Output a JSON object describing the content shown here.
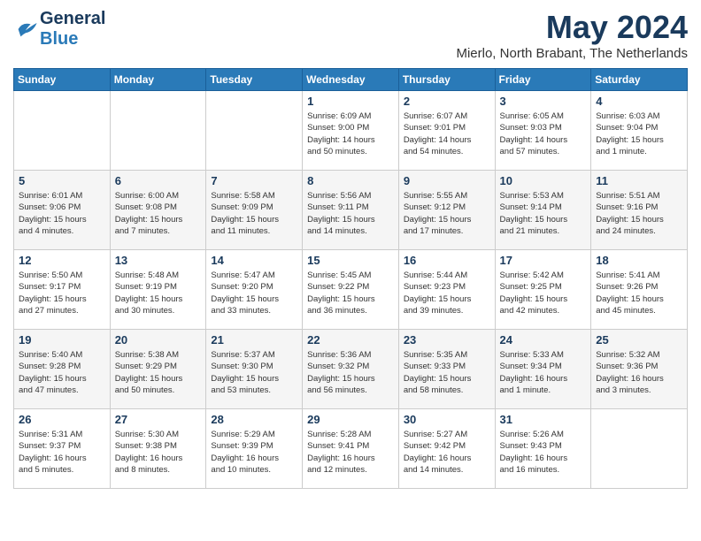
{
  "logo": {
    "line1": "General",
    "line2": "Blue"
  },
  "title": "May 2024",
  "subtitle": "Mierlo, North Brabant, The Netherlands",
  "weekdays": [
    "Sunday",
    "Monday",
    "Tuesday",
    "Wednesday",
    "Thursday",
    "Friday",
    "Saturday"
  ],
  "weeks": [
    [
      {
        "day": "",
        "info": ""
      },
      {
        "day": "",
        "info": ""
      },
      {
        "day": "",
        "info": ""
      },
      {
        "day": "1",
        "info": "Sunrise: 6:09 AM\nSunset: 9:00 PM\nDaylight: 14 hours\nand 50 minutes."
      },
      {
        "day": "2",
        "info": "Sunrise: 6:07 AM\nSunset: 9:01 PM\nDaylight: 14 hours\nand 54 minutes."
      },
      {
        "day": "3",
        "info": "Sunrise: 6:05 AM\nSunset: 9:03 PM\nDaylight: 14 hours\nand 57 minutes."
      },
      {
        "day": "4",
        "info": "Sunrise: 6:03 AM\nSunset: 9:04 PM\nDaylight: 15 hours\nand 1 minute."
      }
    ],
    [
      {
        "day": "5",
        "info": "Sunrise: 6:01 AM\nSunset: 9:06 PM\nDaylight: 15 hours\nand 4 minutes."
      },
      {
        "day": "6",
        "info": "Sunrise: 6:00 AM\nSunset: 9:08 PM\nDaylight: 15 hours\nand 7 minutes."
      },
      {
        "day": "7",
        "info": "Sunrise: 5:58 AM\nSunset: 9:09 PM\nDaylight: 15 hours\nand 11 minutes."
      },
      {
        "day": "8",
        "info": "Sunrise: 5:56 AM\nSunset: 9:11 PM\nDaylight: 15 hours\nand 14 minutes."
      },
      {
        "day": "9",
        "info": "Sunrise: 5:55 AM\nSunset: 9:12 PM\nDaylight: 15 hours\nand 17 minutes."
      },
      {
        "day": "10",
        "info": "Sunrise: 5:53 AM\nSunset: 9:14 PM\nDaylight: 15 hours\nand 21 minutes."
      },
      {
        "day": "11",
        "info": "Sunrise: 5:51 AM\nSunset: 9:16 PM\nDaylight: 15 hours\nand 24 minutes."
      }
    ],
    [
      {
        "day": "12",
        "info": "Sunrise: 5:50 AM\nSunset: 9:17 PM\nDaylight: 15 hours\nand 27 minutes."
      },
      {
        "day": "13",
        "info": "Sunrise: 5:48 AM\nSunset: 9:19 PM\nDaylight: 15 hours\nand 30 minutes."
      },
      {
        "day": "14",
        "info": "Sunrise: 5:47 AM\nSunset: 9:20 PM\nDaylight: 15 hours\nand 33 minutes."
      },
      {
        "day": "15",
        "info": "Sunrise: 5:45 AM\nSunset: 9:22 PM\nDaylight: 15 hours\nand 36 minutes."
      },
      {
        "day": "16",
        "info": "Sunrise: 5:44 AM\nSunset: 9:23 PM\nDaylight: 15 hours\nand 39 minutes."
      },
      {
        "day": "17",
        "info": "Sunrise: 5:42 AM\nSunset: 9:25 PM\nDaylight: 15 hours\nand 42 minutes."
      },
      {
        "day": "18",
        "info": "Sunrise: 5:41 AM\nSunset: 9:26 PM\nDaylight: 15 hours\nand 45 minutes."
      }
    ],
    [
      {
        "day": "19",
        "info": "Sunrise: 5:40 AM\nSunset: 9:28 PM\nDaylight: 15 hours\nand 47 minutes."
      },
      {
        "day": "20",
        "info": "Sunrise: 5:38 AM\nSunset: 9:29 PM\nDaylight: 15 hours\nand 50 minutes."
      },
      {
        "day": "21",
        "info": "Sunrise: 5:37 AM\nSunset: 9:30 PM\nDaylight: 15 hours\nand 53 minutes."
      },
      {
        "day": "22",
        "info": "Sunrise: 5:36 AM\nSunset: 9:32 PM\nDaylight: 15 hours\nand 56 minutes."
      },
      {
        "day": "23",
        "info": "Sunrise: 5:35 AM\nSunset: 9:33 PM\nDaylight: 15 hours\nand 58 minutes."
      },
      {
        "day": "24",
        "info": "Sunrise: 5:33 AM\nSunset: 9:34 PM\nDaylight: 16 hours\nand 1 minute."
      },
      {
        "day": "25",
        "info": "Sunrise: 5:32 AM\nSunset: 9:36 PM\nDaylight: 16 hours\nand 3 minutes."
      }
    ],
    [
      {
        "day": "26",
        "info": "Sunrise: 5:31 AM\nSunset: 9:37 PM\nDaylight: 16 hours\nand 5 minutes."
      },
      {
        "day": "27",
        "info": "Sunrise: 5:30 AM\nSunset: 9:38 PM\nDaylight: 16 hours\nand 8 minutes."
      },
      {
        "day": "28",
        "info": "Sunrise: 5:29 AM\nSunset: 9:39 PM\nDaylight: 16 hours\nand 10 minutes."
      },
      {
        "day": "29",
        "info": "Sunrise: 5:28 AM\nSunset: 9:41 PM\nDaylight: 16 hours\nand 12 minutes."
      },
      {
        "day": "30",
        "info": "Sunrise: 5:27 AM\nSunset: 9:42 PM\nDaylight: 16 hours\nand 14 minutes."
      },
      {
        "day": "31",
        "info": "Sunrise: 5:26 AM\nSunset: 9:43 PM\nDaylight: 16 hours\nand 16 minutes."
      },
      {
        "day": "",
        "info": ""
      }
    ]
  ]
}
